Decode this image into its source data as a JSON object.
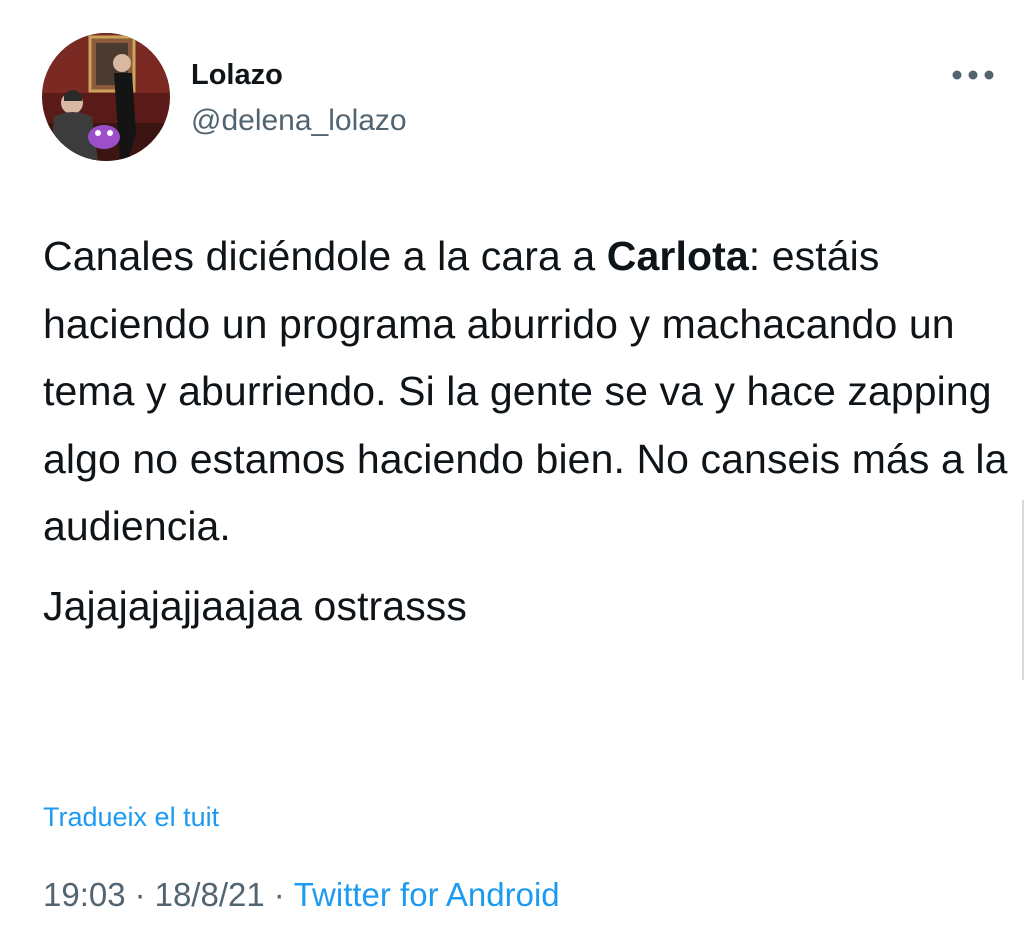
{
  "author": {
    "display_name": "Lolazo",
    "handle": "@delena_lolazo",
    "avatar_icon": "profile-photo"
  },
  "menu": {
    "more_icon": "more-horizontal-icon"
  },
  "tweet": {
    "paragraph1": {
      "before_bold": "Canales diciéndole a la cara a ",
      "bold": "Carlota",
      "after_bold": ": estáis haciendo un programa aburrido y machacando un tema y aburriendo. Si la gente se va y hace zapping algo no estamos haciendo bien. No canseis más a la audiencia."
    },
    "paragraph2": "Jajajajajjaajaa ostrasss",
    "translate_label": "Tradueix el tuit"
  },
  "meta": {
    "time": "19:03",
    "separator": "·",
    "date": "18/8/21",
    "source": "Twitter for Android"
  },
  "colors": {
    "text": "#0f1419",
    "secondary": "#536471",
    "link": "#1d9bf0"
  }
}
